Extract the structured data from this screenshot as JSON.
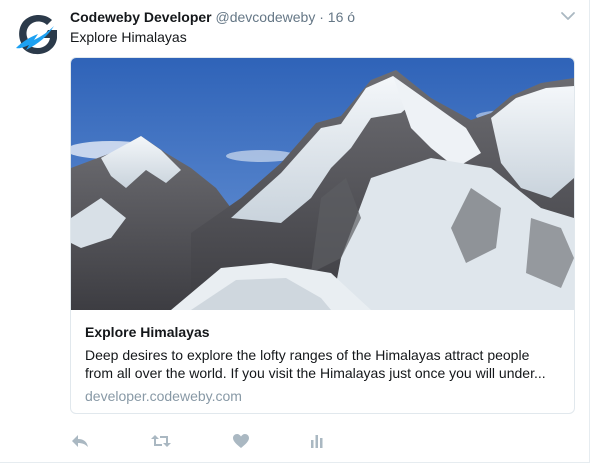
{
  "tweet": {
    "author_name": "Codeweby Developer",
    "author_handle": "@devcodeweby",
    "separator": "·",
    "time": "16 ó",
    "text": "Explore Himalayas"
  },
  "card": {
    "title": "Explore Himalayas",
    "description": "Deep desires to explore the lofty ranges of the Himalayas attract people from all over the world. If you visit the Himalayas just once you will under...",
    "domain": "developer.codeweby.com",
    "image": "himalayas-photo"
  },
  "actions": {
    "reply_icon": "reply-icon",
    "retweet_icon": "retweet-icon",
    "like_icon": "heart-icon",
    "analytics_icon": "analytics-icon"
  },
  "colors": {
    "secondary_text": "#657786",
    "action_icon": "#aab8c2",
    "brand_dark": "#2b3a4a",
    "brand_accent": "#1da1f2"
  }
}
